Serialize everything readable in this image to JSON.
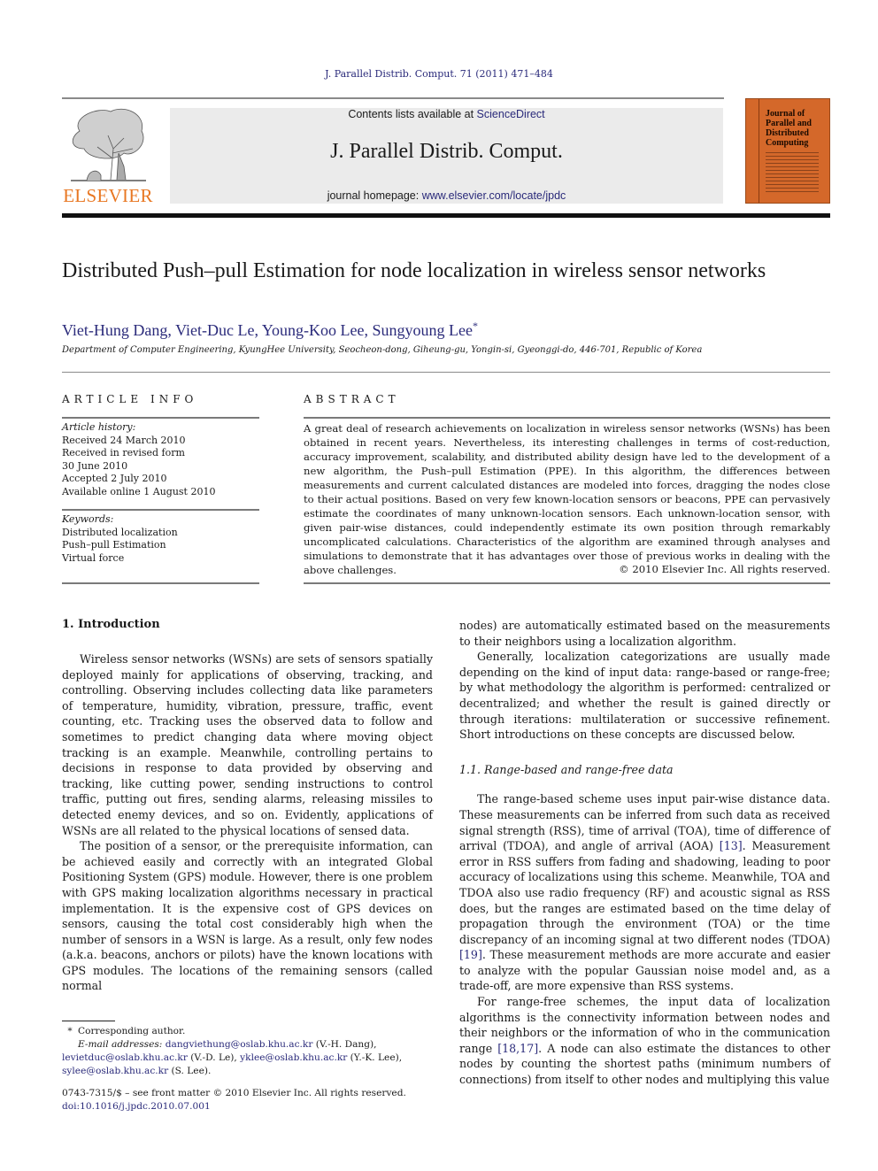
{
  "header": {
    "citation": "J. Parallel Distrib. Comput. 71 (2011) 471–484",
    "publisher_logo_text": "ELSEVIER",
    "contents_prefix": "Contents lists available at ",
    "contents_link": "ScienceDirect",
    "journal_name": "J. Parallel Distrib. Comput.",
    "homepage_prefix": "journal homepage: ",
    "homepage_link": "www.elsevier.com/locate/jpdc",
    "cover_title_lines": [
      "Journal of",
      "Parallel and",
      "Distributed",
      "Computing"
    ],
    "colors": {
      "elsevier_orange": "#e87722",
      "cover_orange": "#d4682a",
      "link_blue": "#2a2a7a",
      "banner_grey": "#ebebeb"
    }
  },
  "article": {
    "title": "Distributed Push–pull Estimation for node localization in wireless sensor networks",
    "authors": [
      "Viet-Hung Dang",
      "Viet-Duc Le",
      "Young-Koo Lee",
      "Sungyoung Lee"
    ],
    "corresponding_mark": "*",
    "affiliation": "Department of Computer Engineering, KyungHee University, Seocheon-dong, Giheung-gu, Yongin-si, Gyeonggi-do, 446-701, Republic of Korea"
  },
  "article_info": {
    "heading": "ARTICLE INFO",
    "history_label": "Article history:",
    "history": [
      "Received 24 March 2010",
      "Received in revised form",
      "30 June 2010",
      "Accepted 2 July 2010",
      "Available online 1 August 2010"
    ],
    "keywords_label": "Keywords:",
    "keywords": [
      "Distributed localization",
      "Push–pull Estimation",
      "Virtual force"
    ]
  },
  "abstract": {
    "heading": "ABSTRACT",
    "text": "A great deal of research achievements on localization in wireless sensor networks (WSNs) has been obtained in recent years. Nevertheless, its interesting challenges in terms of cost-reduction, accuracy improvement, scalability, and distributed ability design have led to the development of a new algorithm, the Push–pull Estimation (PPE). In this algorithm, the differences between measurements and current calculated distances are modeled into forces, dragging the nodes close to their actual positions. Based on very few known-location sensors or beacons, PPE can pervasively estimate the coordinates of many unknown-location sensors. Each unknown-location sensor, with given pair-wise distances, could independently estimate its own position through remarkably uncomplicated calculations. Characteristics of the algorithm are examined through analyses and simulations to demonstrate that it has advantages over those of previous works in dealing with the above challenges.",
    "copyright": "© 2010 Elsevier Inc. All rights reserved."
  },
  "body": {
    "section1_heading": "1.  Introduction",
    "left_paragraphs": [
      "Wireless sensor networks (WSNs) are sets of sensors spatially deployed mainly for applications of observing, tracking, and controlling. Observing includes collecting data like parameters of temperature, humidity, vibration, pressure, traffic, event counting, etc. Tracking uses the observed data to follow and sometimes to predict changing data where moving object tracking is an example. Meanwhile, controlling pertains to decisions in response to data provided by observing and tracking, like cutting power, sending instructions to control traffic, putting out fires, sending alarms, releasing missiles to detected enemy devices, and so on. Evidently, applications of WSNs are all related to the physical locations of sensed data.",
      "The position of a sensor, or the prerequisite information, can be achieved easily and correctly with an integrated Global Positioning System (GPS) module. However, there is one problem with GPS making localization algorithms necessary in practical implementation. It is the expensive cost of GPS devices on sensors, causing the total cost considerably high when the number of sensors in a WSN is large. As a result, only few nodes (a.k.a. beacons, anchors or pilots) have the known locations with GPS modules. The locations of the remaining sensors (called normal"
    ],
    "right_continuation": "nodes) are automatically estimated based on the measurements to their neighbors using a localization algorithm.",
    "right_paragraph2": "Generally, localization categorizations are usually made depending on the kind of input data: range-based or range-free; by what methodology the algorithm is performed: centralized or decentralized; and whether the result is gained directly or through iterations: multilateration or successive refinement. Short introductions on these concepts are discussed below.",
    "subsection_heading": "1.1.  Range-based and range-free data",
    "range_based": {
      "before_ref1": "The range-based scheme uses input pair-wise distance data. These measurements can be inferred from such data as received signal strength (RSS), time of arrival (TOA), time of difference of arrival (TDOA), and angle of arrival (AOA) ",
      "ref1": "[13]",
      "between": ". Measurement error in RSS suffers from fading and shadowing, leading to poor accuracy of localizations using this scheme. Meanwhile, TOA and TDOA also use radio frequency (RF) and acoustic signal as RSS does, but the ranges are estimated based on the time delay of propagation through the environment (TOA) or the time discrepancy of an incoming signal at two different nodes (TDOA) ",
      "ref2": "[19]",
      "after": ". These measurement methods are more accurate and easier to analyze with the popular Gaussian noise model and, as a trade-off, are more expensive than RSS systems."
    },
    "range_free": {
      "before_ref": "For range-free schemes, the input data of localization algorithms is the connectivity information between nodes and their neighbors or the information of who in the communication range ",
      "ref": "[18,17]",
      "after": ". A node can also estimate the distances to other nodes by counting the shortest paths (minimum numbers of connections) from itself to other nodes and multiplying this value"
    }
  },
  "footnotes": {
    "star": "*",
    "corresponding": "Corresponding author.",
    "email_label": "E-mail addresses: ",
    "emails": [
      {
        "address": "dangviethung@oslab.khu.ac.kr",
        "name": " (V.-H. Dang),"
      },
      {
        "address": "levietduc@oslab.khu.ac.kr",
        "name": " (V.-D. Le), "
      },
      {
        "address": "yklee@oslab.khu.ac.kr",
        "name": " (Y.-K. Lee),"
      },
      {
        "address": "sylee@oslab.khu.ac.kr",
        "name": " (S. Lee)."
      }
    ],
    "front_matter": "0743-7315/$ – see front matter © 2010 Elsevier Inc. All rights reserved.",
    "doi": "doi:10.1016/j.jpdc.2010.07.001"
  }
}
